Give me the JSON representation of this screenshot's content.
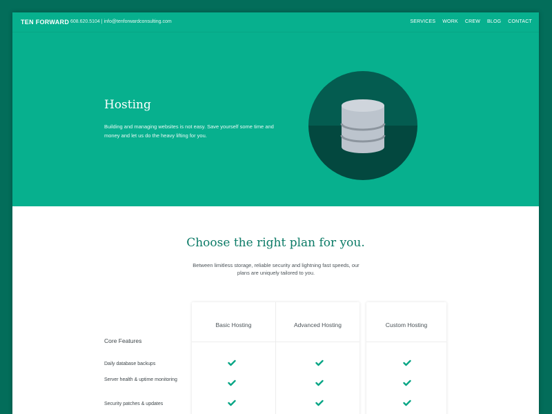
{
  "colors": {
    "page_bg": "#036d5a",
    "hero_bg": "#07b08e",
    "circle_top": "#045c50",
    "circle_bottom": "#03483f",
    "db_body": "#bcc4cd",
    "db_top": "#cfd5dc",
    "db_stripe": "#8c959e",
    "accent": "#0b7a66",
    "check": "#07a585"
  },
  "header": {
    "brand": "TEN FORWARD",
    "phone": "608.620.5104",
    "separator": "|",
    "email": "info@tenforwardconsulting.com",
    "nav": [
      "SERVICES",
      "WORK",
      "CREW",
      "BLOG",
      "CONTACT"
    ]
  },
  "hero": {
    "title": "Hosting",
    "text": "Building and managing websites is not easy. Save yourself some time and money and let us do the heavy lifting for you.",
    "icon": "database-icon"
  },
  "plans": {
    "title": "Choose the right plan for you.",
    "subtitle": "Between limitless storage, reliable security and lightning fast speeds, our plans are uniquely tailored to you.",
    "columns": [
      "Basic Hosting",
      "Advanced Hosting",
      "Custom Hosting"
    ],
    "section_title": "Core Features",
    "features": [
      {
        "label": "Daily database backups",
        "basic": true,
        "advanced": true,
        "custom": true
      },
      {
        "label": "Server health & uptime monitoring",
        "basic": true,
        "advanced": true,
        "custom": true
      },
      {
        "label": "Security patches & updates",
        "basic": true,
        "advanced": true,
        "custom": true
      }
    ]
  }
}
